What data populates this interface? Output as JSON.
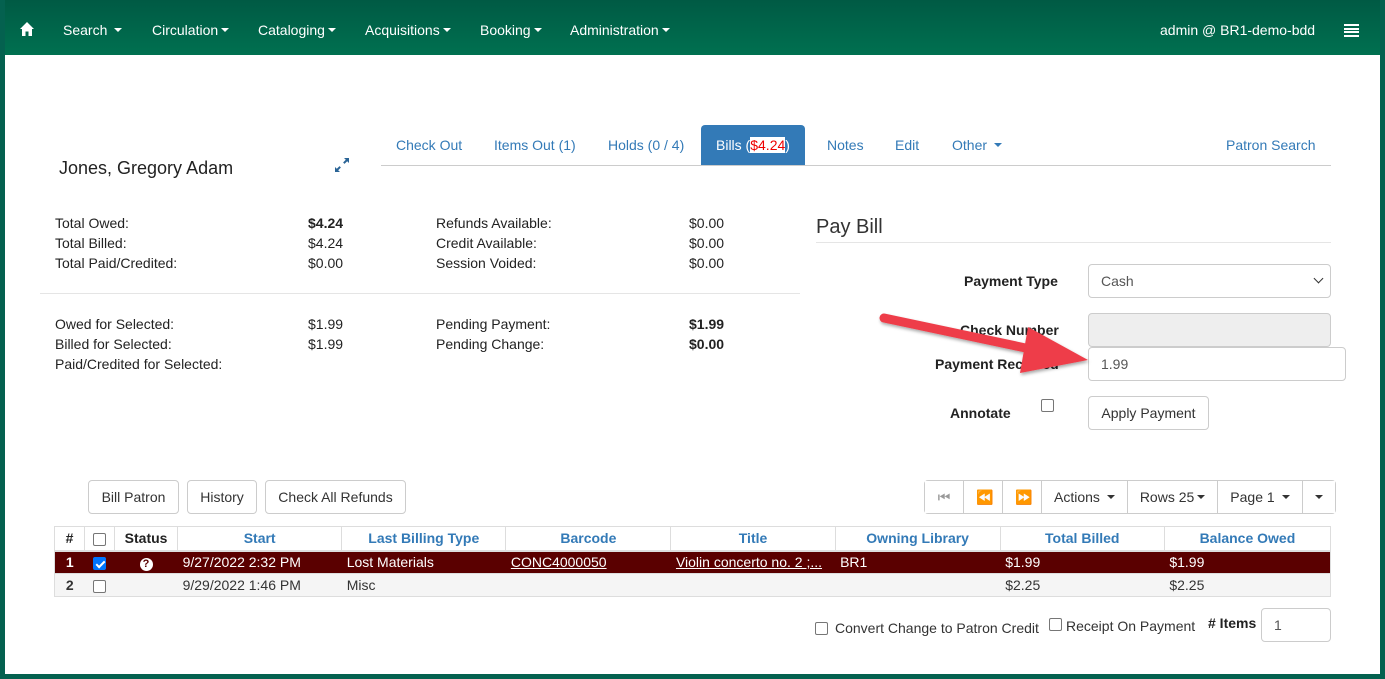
{
  "navbar": {
    "home_icon": "home-icon",
    "items": [
      "Search",
      "Circulation",
      "Cataloging",
      "Acquisitions",
      "Booking",
      "Administration"
    ],
    "user": "admin @ BR1-demo-bdd",
    "menu_icon": "list-icon"
  },
  "patron": {
    "name": "Jones, Gregory Adam",
    "expand_icon": "expand-icon"
  },
  "tabs": {
    "items": [
      {
        "label": "Check Out"
      },
      {
        "label": "Items Out (1)"
      },
      {
        "label": "Holds (0 / 4)"
      },
      {
        "label_prefix": "Bills (",
        "amount": "$4.24",
        "label_suffix": ")",
        "active": true
      },
      {
        "label": "Notes"
      },
      {
        "label": "Edit"
      },
      {
        "label": "Other"
      }
    ],
    "patron_search": "Patron Search"
  },
  "summary": {
    "left": [
      {
        "label": "Total Owed:",
        "value": "$4.24",
        "bold": true
      },
      {
        "label": "Total Billed:",
        "value": "$4.24"
      },
      {
        "label": "Total Paid/Credited:",
        "value": "$0.00"
      }
    ],
    "right": [
      {
        "label": "Refunds Available:",
        "value": "$0.00"
      },
      {
        "label": "Credit Available:",
        "value": "$0.00"
      },
      {
        "label": "Session Voided:",
        "value": "$0.00"
      }
    ],
    "selected_left": [
      {
        "label": "Owed for Selected:",
        "value": "$1.99"
      },
      {
        "label": "Billed for Selected:",
        "value": "$1.99"
      },
      {
        "label": "Paid/Credited for Selected:",
        "value": ""
      }
    ],
    "selected_right": [
      {
        "label": "Pending Payment:",
        "value": "$1.99",
        "bold": true
      },
      {
        "label": "Pending Change:",
        "value": "$0.00",
        "bold": true
      }
    ]
  },
  "pay_bill": {
    "title": "Pay Bill",
    "payment_type_label": "Payment Type",
    "payment_type_value": "Cash",
    "check_number_label": "Check Number",
    "check_number_value": "",
    "payment_received_label": "Payment Received",
    "payment_received_value": "1.99",
    "annotate_label": "Annotate",
    "annotate_checked": false,
    "apply_button": "Apply Payment"
  },
  "toolbar": {
    "bill_patron": "Bill Patron",
    "history": "History",
    "check_all_refunds": "Check All Refunds",
    "pager": {
      "first_icon": "first-page-icon",
      "prev_icon": "previous-page-icon",
      "next_icon": "next-page-icon",
      "actions": "Actions",
      "rows": "Rows 25",
      "page": "Page 1"
    }
  },
  "table": {
    "columns": [
      "#",
      "",
      "Status",
      "Start",
      "Last Billing Type",
      "Barcode",
      "Title",
      "Owning Library",
      "Total Billed",
      "Balance Owed"
    ],
    "rows": [
      {
        "num": "1",
        "checked": true,
        "status_icon": "question-circle-icon",
        "start": "9/27/2022 2:32 PM",
        "billing_type": "Lost Materials",
        "barcode": "CONC4000050",
        "title": "Violin concerto no. 2 ;...",
        "library": "BR1",
        "total_billed": "$1.99",
        "balance_owed": "$1.99",
        "selected": true
      },
      {
        "num": "2",
        "checked": false,
        "status_icon": "",
        "start": "9/29/2022 1:46 PM",
        "billing_type": "Misc",
        "barcode": "",
        "title": "",
        "library": "",
        "total_billed": "$2.25",
        "balance_owed": "$2.25",
        "selected": false
      }
    ]
  },
  "footer": {
    "convert_change": "Convert Change to Patron Credit",
    "receipt_on_payment": "Receipt On Payment",
    "items_label": "# Items",
    "items_value": "1"
  },
  "colors": {
    "brand_green": "#00704f",
    "link_blue": "#337ab7",
    "selected_row": "#5a0000",
    "annotation_arrow": "#ee3d48"
  }
}
